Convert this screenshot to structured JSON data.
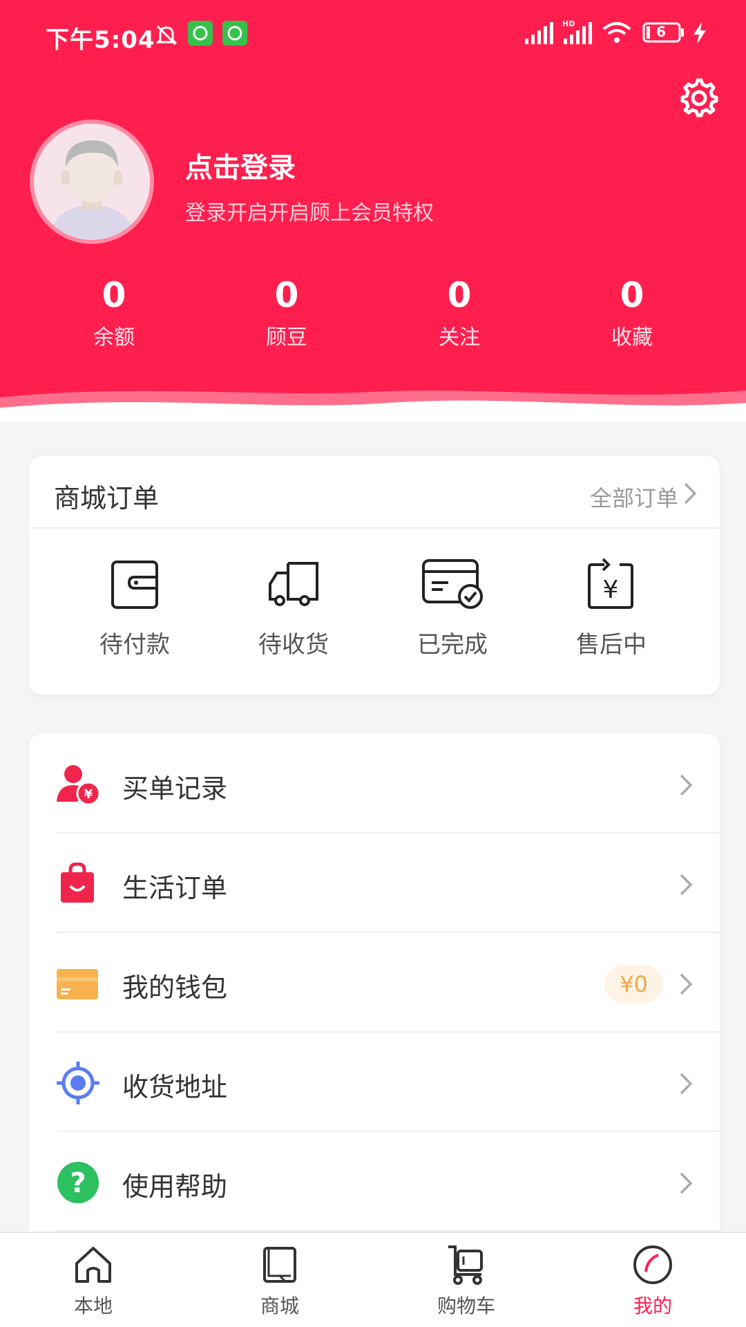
{
  "status_bar": {
    "time": "下午5:04",
    "battery": "6"
  },
  "profile": {
    "login_title": "点击登录",
    "login_subtitle": "登录开启开启顾上会员特权"
  },
  "stats": [
    {
      "value": "0",
      "label": "余额"
    },
    {
      "value": "0",
      "label": "顾豆"
    },
    {
      "value": "0",
      "label": "关注"
    },
    {
      "value": "0",
      "label": "收藏"
    }
  ],
  "orders": {
    "title": "商城订单",
    "all_label": "全部订单",
    "items": [
      {
        "label": "待付款",
        "icon": "wallet-icon"
      },
      {
        "label": "待收货",
        "icon": "truck-icon"
      },
      {
        "label": "已完成",
        "icon": "card-check-icon"
      },
      {
        "label": "售后中",
        "icon": "refund-icon"
      }
    ]
  },
  "menu": [
    {
      "label": "买单记录",
      "icon": "user-yuan-icon"
    },
    {
      "label": "生活订单",
      "icon": "shopping-bag-icon"
    },
    {
      "label": "我的钱包",
      "icon": "card-icon",
      "badge": "¥0"
    },
    {
      "label": "收货地址",
      "icon": "location-target-icon"
    },
    {
      "label": "使用帮助",
      "icon": "help-icon"
    }
  ],
  "tabbar": [
    {
      "label": "本地",
      "icon": "home-icon"
    },
    {
      "label": "商城",
      "icon": "shop-icon"
    },
    {
      "label": "购物车",
      "icon": "cart-icon"
    },
    {
      "label": "我的",
      "icon": "me-icon",
      "active": true
    }
  ],
  "colors": {
    "brand": "#ff1f4f",
    "badge_text": "#f0a84a"
  }
}
